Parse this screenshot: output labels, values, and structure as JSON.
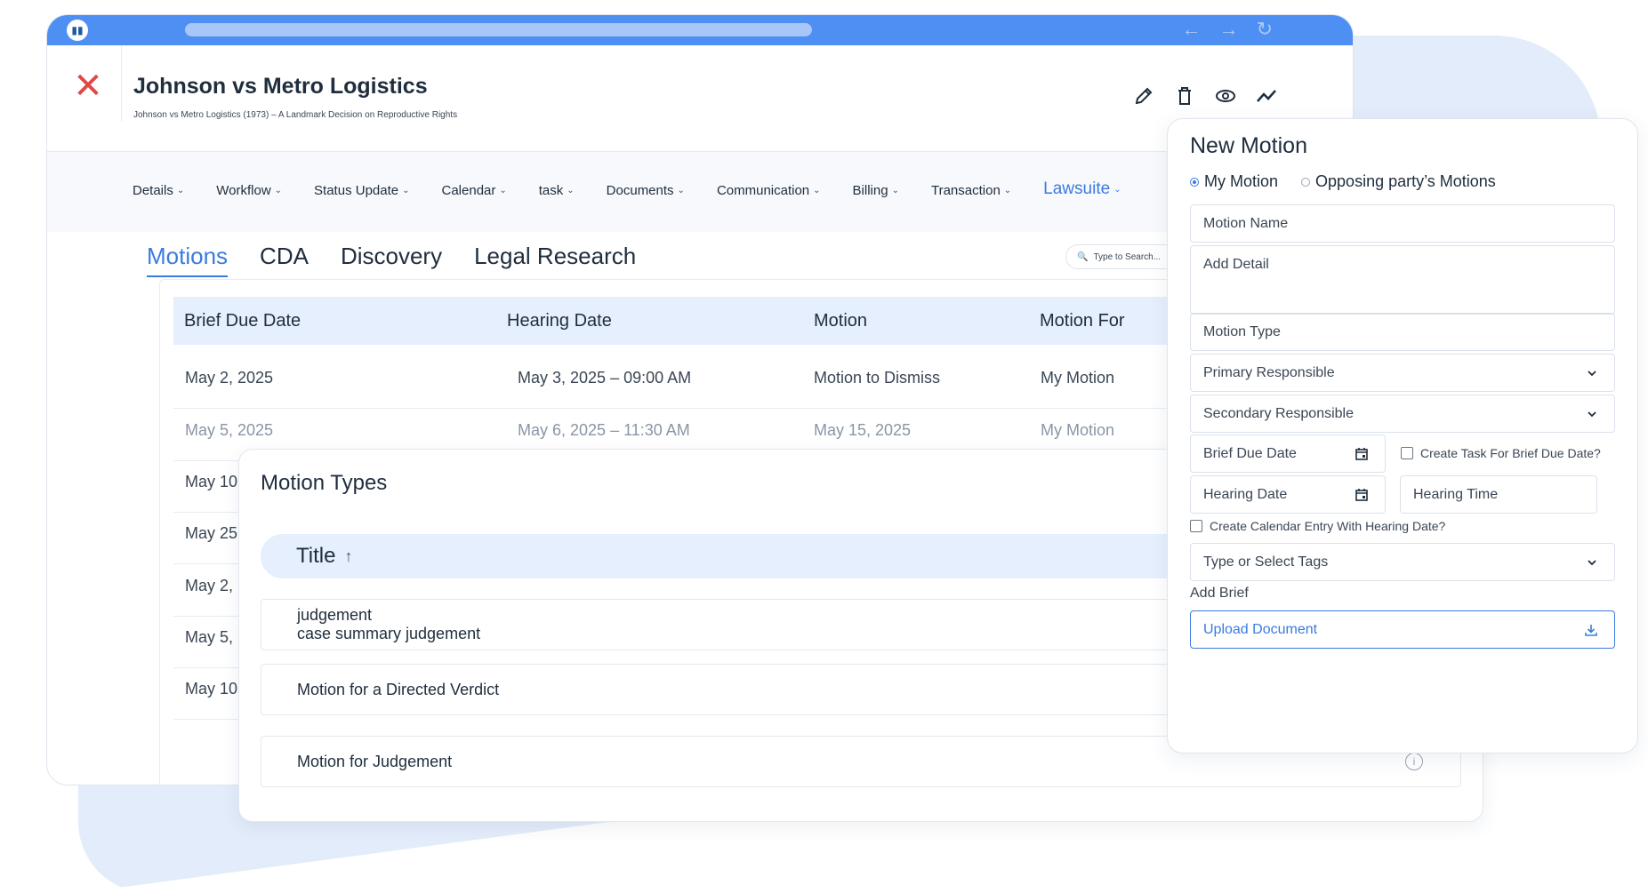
{
  "window": {
    "case_title": "Johnson vs Metro Logistics",
    "case_subtitle": "Johnson vs Metro Logistics (1973) – A Landmark Decision on Reproductive Rights",
    "close_icon": "close-icon",
    "nav_icons": [
      "back-arrow-icon",
      "forward-arrow-icon",
      "refresh-icon"
    ],
    "actions": [
      "edit-icon",
      "delete-icon",
      "view-icon",
      "activity-icon"
    ]
  },
  "nav": {
    "items": [
      {
        "label": "Details",
        "active": false
      },
      {
        "label": "Workflow",
        "active": false
      },
      {
        "label": "Status Update",
        "active": false
      },
      {
        "label": "Calendar",
        "active": false
      },
      {
        "label": "task",
        "active": false
      },
      {
        "label": "Documents",
        "active": false
      },
      {
        "label": "Communication",
        "active": false
      },
      {
        "label": "Billing",
        "active": false
      },
      {
        "label": "Transaction",
        "active": false
      },
      {
        "label": "Lawsuite",
        "active": true
      }
    ]
  },
  "subtabs": {
    "items": [
      "Motions",
      "CDA",
      "Discovery",
      "Legal Research"
    ],
    "active": "Motions"
  },
  "search": {
    "placeholder": "Type to Search..."
  },
  "motions_table": {
    "headers": [
      "Brief Due Date",
      "Hearing Date",
      "Motion",
      "Motion For"
    ],
    "rows": [
      [
        "May 2, 2025",
        "May 3, 2025 – 09:00 AM",
        "Motion to Dismiss",
        "My Motion"
      ],
      [
        "May 5, 2025",
        "May 6, 2025 – 11:30 AM",
        "May 15, 2025",
        "My Motion"
      ],
      [
        "May 10",
        "",
        "",
        ""
      ],
      [
        "May 25",
        "",
        "",
        ""
      ],
      [
        "May 2,",
        "",
        "",
        ""
      ],
      [
        "May 5,",
        "",
        "",
        ""
      ],
      [
        "May 10",
        "",
        "",
        ""
      ]
    ]
  },
  "motion_types": {
    "title": "Motion Types",
    "column": "Title",
    "rows": [
      {
        "lines": [
          "judgement",
          "case summary judgement"
        ]
      },
      {
        "lines": [
          "Motion for a Directed Verdict"
        ]
      },
      {
        "lines": [
          "Motion for Judgement"
        ]
      }
    ]
  },
  "new_motion": {
    "title": "New Motion",
    "radios": [
      {
        "label": "My Motion",
        "checked": true
      },
      {
        "label": "Opposing party’s Motions",
        "checked": false
      }
    ],
    "motion_name": "Motion Name",
    "add_detail": "Add Detail",
    "motion_type": "Motion Type",
    "primary_responsible": "Primary Responsible",
    "secondary_responsible": "Secondary Responsible",
    "brief_due_date": "Brief Due Date",
    "create_task_label": "Create  Task For Brief Due Date?",
    "hearing_date": "Hearing Date",
    "hearing_time": "Hearing Time",
    "calendar_entry_label": "Create Calendar Entry With Hearing Date?",
    "tags": "Type or Select Tags",
    "add_brief": "Add Brief",
    "upload": "Upload Document"
  },
  "colors": {
    "accent": "#3a7be0",
    "topbar": "#4d8ff3",
    "close": "#e04848",
    "header_bg": "#e6effd"
  }
}
